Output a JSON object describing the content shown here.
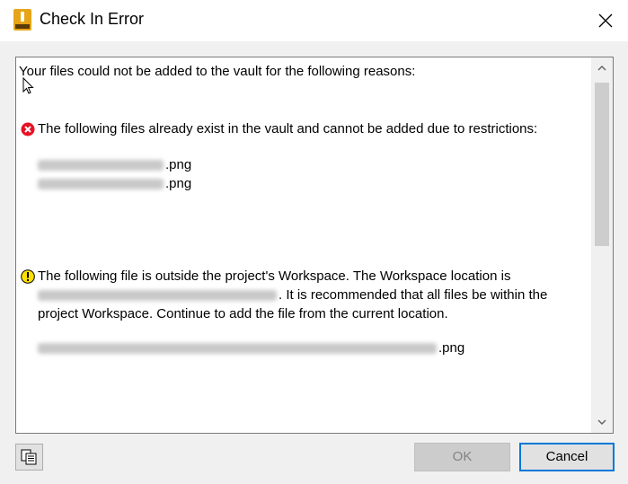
{
  "window": {
    "title": "Check In Error",
    "icon": "inventor-app-icon",
    "close_icon": "close-icon"
  },
  "message": {
    "intro": "Your files could not be added to the vault for the following reasons:",
    "error_section": {
      "icon": "error-icon",
      "color": "#e81123",
      "text": "The following files already exist in the vault and cannot be added due to restrictions:",
      "files": [
        ".png",
        ".png"
      ]
    },
    "warning_section": {
      "icon": "warning-icon",
      "color": "#fce100",
      "text_line1": "The following file is outside the project's Workspace.  The Workspace location is",
      "text_line2_suffix": ".  It is recommended that all files be within the",
      "text_line3": "project Workspace.  Continue to add the file from the current location.",
      "file": ".png"
    }
  },
  "buttons": {
    "ok": "OK",
    "cancel": "Cancel",
    "copy_icon": "copy-to-clipboard-icon"
  },
  "colors": {
    "accent": "#0078d7",
    "disabled_button": "#cccccc"
  }
}
